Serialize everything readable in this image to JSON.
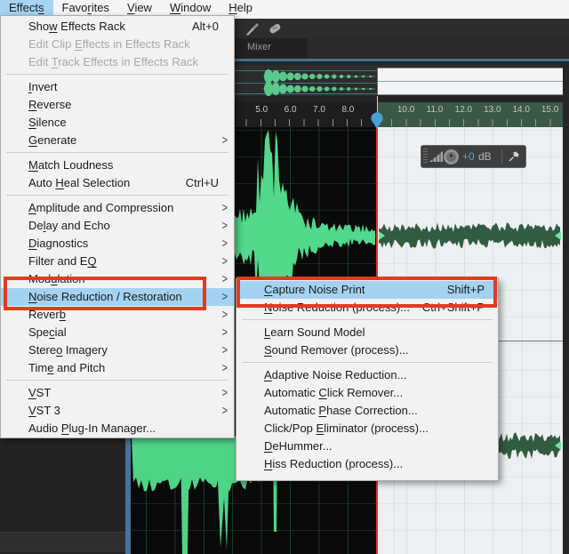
{
  "menubar": {
    "items": [
      {
        "pre": "Effect",
        "ul": "s",
        "post": "",
        "open": true
      },
      {
        "pre": "Favo",
        "ul": "r",
        "post": "ites"
      },
      {
        "pre": "",
        "ul": "V",
        "post": "iew"
      },
      {
        "pre": "",
        "ul": "W",
        "post": "indow"
      },
      {
        "pre": "",
        "ul": "H",
        "post": "elp"
      }
    ]
  },
  "effects_menu": {
    "items": [
      {
        "pre": "Sho",
        "ul": "w",
        "post": " Effects Rack",
        "shortcut": "Alt+0"
      },
      {
        "pre": "Edit Clip ",
        "ul": "E",
        "post": "ffects in Effects Rack",
        "disabled": true
      },
      {
        "pre": "Edit ",
        "ul": "T",
        "post": "rack Effects in Effects Rack",
        "disabled": true
      },
      {
        "sep": true
      },
      {
        "pre": "",
        "ul": "I",
        "post": "nvert"
      },
      {
        "pre": "",
        "ul": "R",
        "post": "everse"
      },
      {
        "pre": "",
        "ul": "S",
        "post": "ilence"
      },
      {
        "pre": "",
        "ul": "G",
        "post": "enerate",
        "submenu": true
      },
      {
        "sep": true
      },
      {
        "pre": "",
        "ul": "M",
        "post": "atch Loudness"
      },
      {
        "pre": "Auto ",
        "ul": "H",
        "post": "eal Selection",
        "shortcut": "Ctrl+U"
      },
      {
        "sep": true
      },
      {
        "pre": "",
        "ul": "A",
        "post": "mplitude and Compression",
        "submenu": true
      },
      {
        "pre": "De",
        "ul": "l",
        "post": "ay and Echo",
        "submenu": true
      },
      {
        "pre": "",
        "ul": "D",
        "post": "iagnostics",
        "submenu": true
      },
      {
        "pre": "Filter and E",
        "ul": "Q",
        "post": "",
        "submenu": true
      },
      {
        "pre": "Mod",
        "ul": "u",
        "post": "lation",
        "submenu": true
      },
      {
        "pre": "",
        "ul": "N",
        "post": "oise Reduction / Restoration",
        "submenu": true,
        "highlighted": true
      },
      {
        "pre": "Rever",
        "ul": "b",
        "post": "",
        "submenu": true
      },
      {
        "pre": "Spe",
        "ul": "c",
        "post": "ial",
        "submenu": true
      },
      {
        "pre": "Stere",
        "ul": "o",
        "post": " Imagery",
        "submenu": true
      },
      {
        "pre": "Tim",
        "ul": "e",
        "post": " and Pitch",
        "submenu": true
      },
      {
        "sep": true
      },
      {
        "pre": "",
        "ul": "V",
        "post": "ST",
        "submenu": true
      },
      {
        "pre": "",
        "ul": "V",
        "post": "ST 3",
        "submenu": true
      },
      {
        "pre": "Audio ",
        "ul": "P",
        "post": "lug-In Manager..."
      }
    ]
  },
  "noise_submenu": {
    "items": [
      {
        "pre": "",
        "ul": "C",
        "post": "apture Noise Print",
        "shortcut": "Shift+P",
        "highlighted": true
      },
      {
        "pre": "",
        "ul": "N",
        "post": "oise Reduction (process)...",
        "shortcut": "Ctrl+Shift+P"
      },
      {
        "sep": true
      },
      {
        "pre": "",
        "ul": "L",
        "post": "earn Sound Model"
      },
      {
        "pre": "",
        "ul": "S",
        "post": "ound Remover (process)..."
      },
      {
        "sep": true
      },
      {
        "pre": "",
        "ul": "A",
        "post": "daptive Noise Reduction..."
      },
      {
        "pre": "Automatic ",
        "ul": "C",
        "post": "lick Remover..."
      },
      {
        "pre": "Automatic ",
        "ul": "P",
        "post": "hase Correction..."
      },
      {
        "pre": "Click/Pop ",
        "ul": "E",
        "post": "liminator (process)..."
      },
      {
        "pre": "",
        "ul": "D",
        "post": "eHummer..."
      },
      {
        "pre": "",
        "ul": "H",
        "post": "iss Reduction (process)..."
      }
    ]
  },
  "editor": {
    "mixer_tab": "Mixer",
    "ruler": {
      "left_labels": [
        "5.0",
        "6.0",
        "7.0",
        "8.0"
      ],
      "right_labels": [
        "10.0",
        "11.0",
        "12.0",
        "13.0",
        "14.0",
        "15.0"
      ]
    },
    "hud": {
      "gain_value": "+0",
      "unit": "dB"
    },
    "icons": [
      "paintbrush-icon",
      "bandaid-icon",
      "volume-ramp-icon",
      "knob-icon",
      "pin-icon",
      "submenu-arrow-icon",
      "playhead-marker"
    ]
  },
  "colors": {
    "callout_red": "#e23b1e",
    "menu_highlight_blue": "#a4d3f1",
    "waveform_green": "#52d98c",
    "selection_waveform_green": "#315c40",
    "selection_bg": "#edf0f2",
    "playhead_blue": "#4aa0d6",
    "cti_red": "#d8372a"
  }
}
